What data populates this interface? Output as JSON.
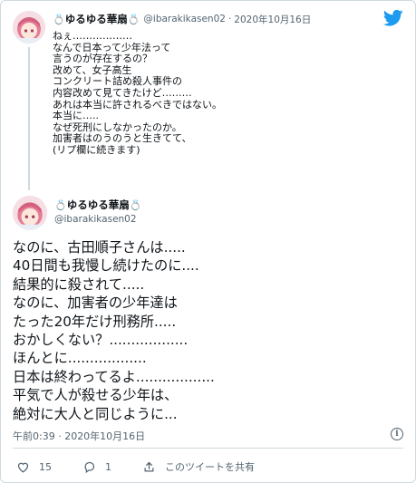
{
  "parent": {
    "display_name": "ゆるゆる華扇",
    "handle": "@ibarakikasen02",
    "separator": "·",
    "date": "2020年10月16日",
    "lines": [
      "ねぇ………………",
      "なんで日本って少年法って",
      "言うのが存在するの？",
      "改めて、女子高生",
      "コンクリート詰め殺人事件の",
      "内容改めて見てきたけど………",
      "あれは本当に許されるべきではない。",
      "本当に…..",
      "なぜ死刑にしなかったのか。",
      "加害者はのうのうと生きてて、",
      "(リプ欄に続きます)"
    ]
  },
  "tweet": {
    "display_name": "ゆるゆる華扇",
    "handle": "@ibarakikasen02",
    "lines": [
      "なのに、古田順子さんは.....",
      "40日間も我慢し続けたのに....",
      "結果的に殺されて.....",
      "なのに、加害者の少年達は",
      "たった20年だけ刑務所.....",
      "おかしくない？..................",
      "ほんとに..................",
      "日本は終わってるよ..................",
      "平気で人が殺せる少年は、",
      "絶対に大人と同じように..."
    ],
    "timestamp": "午前0:39 · 2020年10月16日",
    "info_glyph": "i",
    "likes": "15",
    "replies": "1",
    "share_label": "このツイートを共有"
  },
  "icons": {
    "ring": "💍",
    "brand": "twitter-bird-icon",
    "heart": "heart-icon",
    "reply": "reply-icon",
    "share": "share-icon"
  },
  "colors": {
    "brand": "#1d9bf0",
    "text": "#0f1419",
    "muted": "#536471",
    "border": "#cfd9de"
  }
}
